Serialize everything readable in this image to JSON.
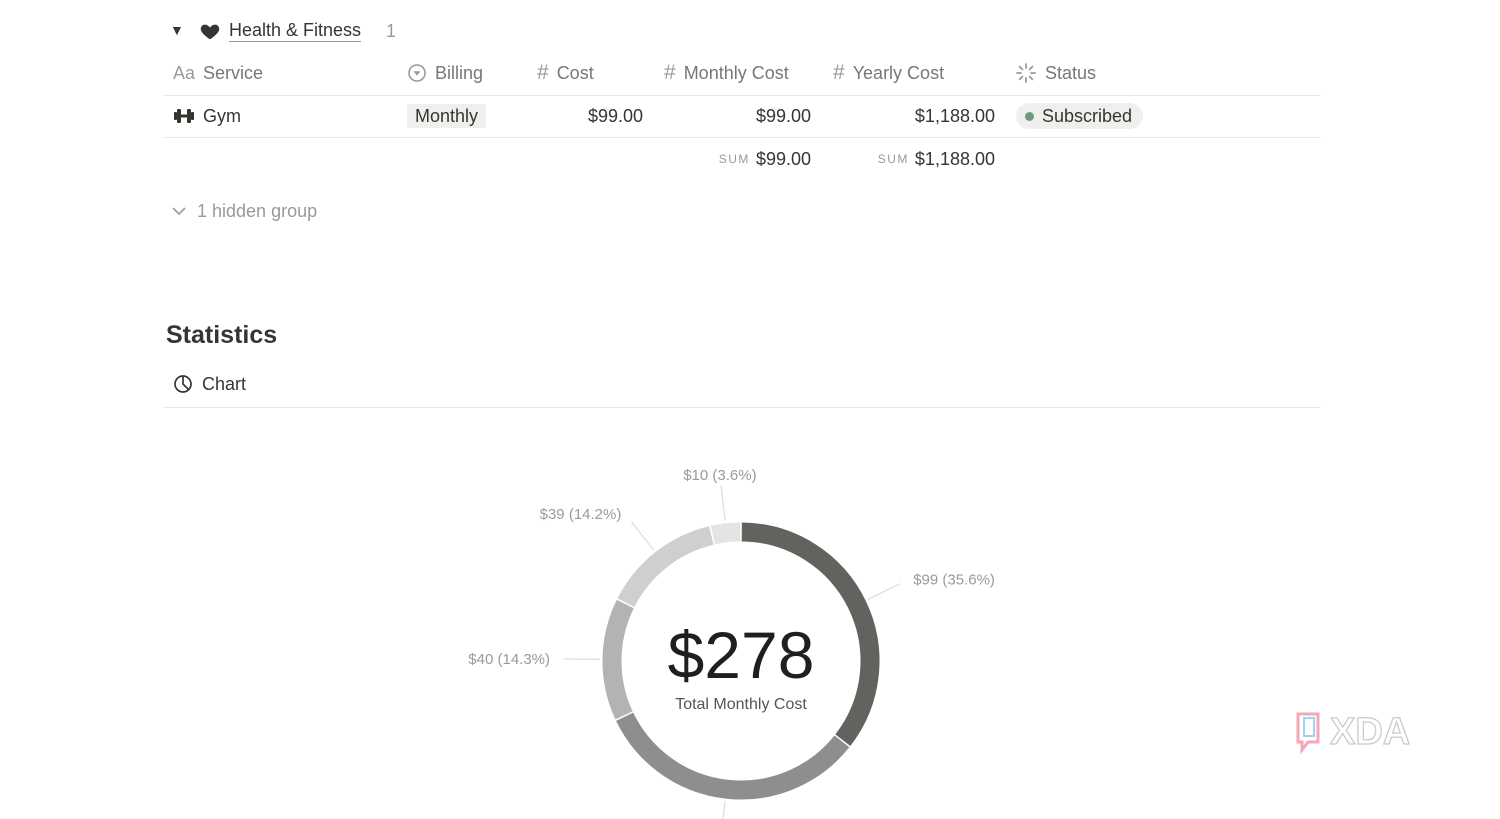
{
  "group": {
    "toggle": "▼",
    "name": "Health & Fitness",
    "count": "1"
  },
  "columns": {
    "service": "Service",
    "service_prefix": "Aa",
    "billing": "Billing",
    "cost": "Cost",
    "monthly_cost": "Monthly Cost",
    "yearly_cost": "Yearly Cost",
    "status": "Status"
  },
  "rows": [
    {
      "service": "Gym",
      "billing": "Monthly",
      "cost": "$99.00",
      "monthly_cost": "$99.00",
      "yearly_cost": "$1,188.00",
      "status": "Subscribed"
    }
  ],
  "footer": {
    "sum_label": "SUM",
    "monthly_sum": "$99.00",
    "yearly_sum": "$1,188.00"
  },
  "hidden_groups": "1 hidden group",
  "statistics": {
    "title": "Statistics",
    "tab": "Chart"
  },
  "colors": {
    "status_green": "#6c9b7d",
    "pill_bg": "#efefee",
    "text": "#37352f",
    "muted": "#9b9a97"
  },
  "watermark": "XDA",
  "chart_data": {
    "type": "pie",
    "donut": true,
    "center_value": "$278",
    "center_label": "Total Monthly Cost",
    "slices": [
      {
        "label": "$99 (35.6%)",
        "value": 99,
        "percent": 35.6,
        "color": "#62625e"
      },
      {
        "label": "",
        "value": 90,
        "percent": 32.3,
        "color": "#8e8e8c"
      },
      {
        "label": "$40 (14.3%)",
        "value": 40,
        "percent": 14.3,
        "color": "#b3b3b1"
      },
      {
        "label": "$39 (14.2%)",
        "value": 39,
        "percent": 14.2,
        "color": "#cfcfce"
      },
      {
        "label": "$10 (3.6%)",
        "value": 10,
        "percent": 3.6,
        "color": "#e4e4e3"
      }
    ]
  }
}
